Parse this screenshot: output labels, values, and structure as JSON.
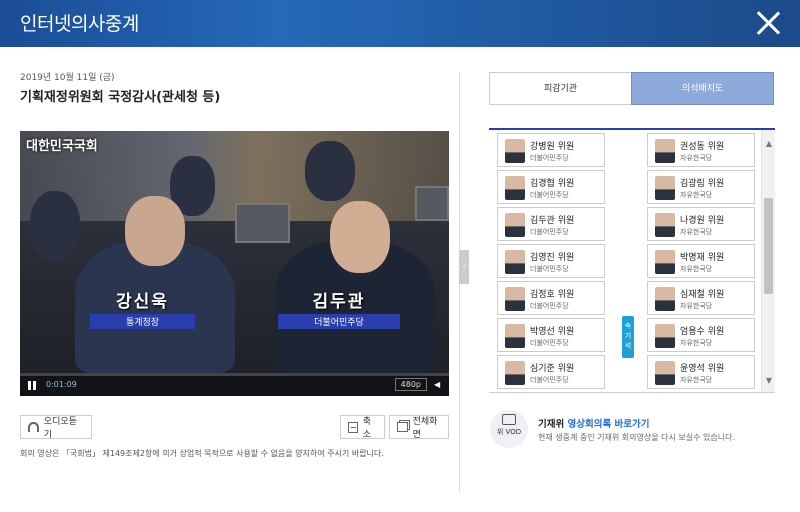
{
  "window": {
    "title": "인터넷의사중계"
  },
  "session": {
    "date": "2019년 10월 11일 (금)",
    "title": "기획재정위원회 국정감사(관세청 등)"
  },
  "video": {
    "overlay_logo": "대한민국국회",
    "left_caption": {
      "name": "강신욱",
      "tag": "통계청장"
    },
    "right_caption": {
      "name": "김두관",
      "tag": "더불어민주당"
    },
    "time": "0:01:09",
    "quality": "480p"
  },
  "buttons": {
    "audio": "오디오듣기",
    "shrink": "축소",
    "fullscreen": "전체화면"
  },
  "notice": "회의 영상은 「국회법」 제149조제2항에 의거 상업적 목적으로 사용할 수 없음을 양지하여 주시기 바랍니다.",
  "tabs": {
    "agency": "피감기관",
    "seating": "의석배치도"
  },
  "seating": {
    "speaker_label": "속기석",
    "left": [
      {
        "name": "강병원 위원",
        "party": "더불어민주당"
      },
      {
        "name": "김경협 위원",
        "party": "더불어민주당"
      },
      {
        "name": "김두관 위원",
        "party": "더불어민주당"
      },
      {
        "name": "김영진 위원",
        "party": "더불어민주당"
      },
      {
        "name": "김정호 위원",
        "party": "더불어민주당"
      },
      {
        "name": "박영선 위원",
        "party": "더불어민주당"
      },
      {
        "name": "심기준 위원",
        "party": "더불어민주당"
      }
    ],
    "right": [
      {
        "name": "권성동 위원",
        "party": "자유한국당"
      },
      {
        "name": "김광림 위원",
        "party": "자유한국당"
      },
      {
        "name": "나경원 위원",
        "party": "자유한국당"
      },
      {
        "name": "박명재 위원",
        "party": "자유한국당"
      },
      {
        "name": "심재철 위원",
        "party": "자유한국당"
      },
      {
        "name": "엄용수 위원",
        "party": "자유한국당"
      },
      {
        "name": "윤영석 위원",
        "party": "자유한국당"
      }
    ]
  },
  "vod": {
    "icon_label": "위 VOD",
    "title_prefix": "기재위",
    "title_link": "영상회의록 바로가기",
    "desc": "현재 생중계 중인 기재위 회의영상을 다시 보실수 있습니다."
  }
}
